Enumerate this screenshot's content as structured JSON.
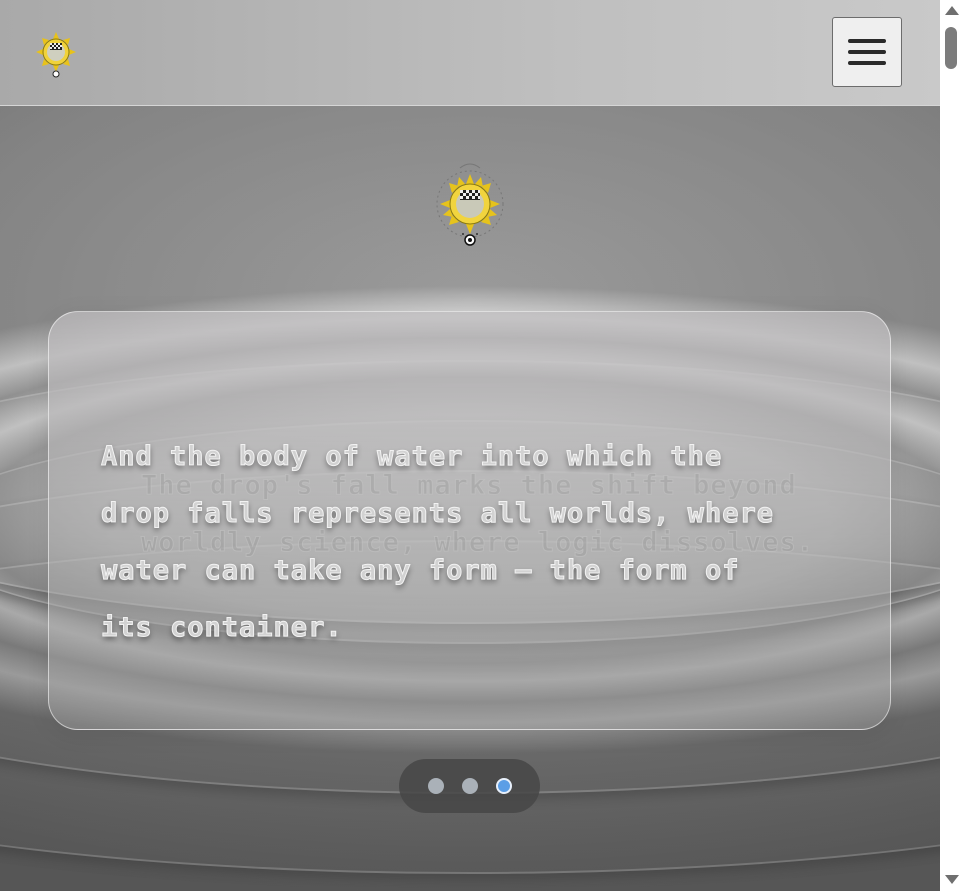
{
  "header": {
    "logo_icon": "sunflower-emblem-logo",
    "menu_icon": "hamburger-menu-icon"
  },
  "hero": {
    "logo_icon": "sunflower-emblem-logo"
  },
  "carousel": {
    "active_slide_text": "And the body of water into which the drop falls represents all worlds, where water can take any form – the form of its container.",
    "previous_slide_text": "The drop's fall marks the shift beyond worldly science, where logic dissolves.",
    "slide_count": 3,
    "active_index": 2
  },
  "colors": {
    "active_dot": "#5b9ee6",
    "inactive_dot": "#aab1b8",
    "dots_pill": "#464646"
  }
}
